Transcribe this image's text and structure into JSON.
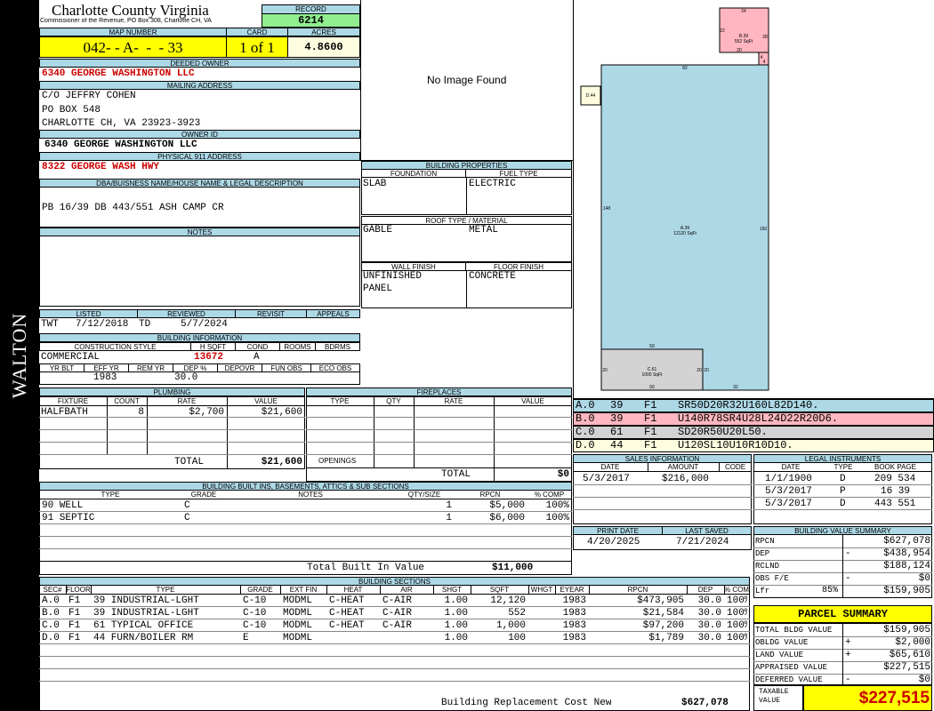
{
  "side_label": "WALTON",
  "county": {
    "title": "Charlotte County Virginia",
    "subtitle": "Commissioner of the Revenue, PO Box 308, Charlotte CH, VA"
  },
  "record": {
    "label": "RECORD",
    "value": "6214"
  },
  "map": {
    "label": "MAP NUMBER",
    "value": "042- - A-  -  - 33",
    "card_label": "CARD",
    "card": "1 of 1",
    "acres_label": "ACRES",
    "acres": "4.8600"
  },
  "owner": {
    "label": "DEEDED OWNER",
    "name": "6340 GEORGE WASHINGTON LLC",
    "mail_label": "MAILING ADDRESS",
    "mail": [
      "C/O JEFFRY COHEN",
      "PO BOX 548",
      "CHARLOTTE CH, VA 23923-3923"
    ],
    "id_label": "OWNER ID",
    "id": "6340 GEORGE WASHINGTON LLC",
    "addr_label": "PHYSICAL 911 ADDRESS",
    "addr": "8322 GEORGE WASH HWY"
  },
  "legal": {
    "label": "DBA/BUISNESS NAME/HOUSE NAME & LEGAL DESCRIPTION",
    "text": "PB 16/39 DB 443/551 ASH CAMP CR"
  },
  "notes": {
    "label": "NOTES"
  },
  "photo": {
    "text": "No Image Found"
  },
  "props": {
    "label": "BUILDING PROPERTIES",
    "foundation_label": "FOUNDATION",
    "foundation": "SLAB",
    "fuel_label": "FUEL TYPE",
    "fuel": "ELECTRIC",
    "roof_label": "ROOF TYPE / MATERIAL",
    "roof_type": "GABLE",
    "roof_mat": "METAL",
    "wall_label": "WALL FINISH",
    "wall": [
      "UNFINISHED",
      "PANEL"
    ],
    "floor_label": "FLOOR FINISH",
    "floor": "CONCRETE"
  },
  "status": {
    "listed_label": "LISTED",
    "listed_by": "TWT",
    "listed": "7/12/2018",
    "reviewed_label": "REVIEWED",
    "reviewed_by": "TD",
    "reviewed": "5/7/2024",
    "revisit_label": "REVISIT",
    "appeals_label": "APPEALS"
  },
  "info": {
    "label": "BUILDING INFORMATION",
    "style_label": "CONSTRUCTION STYLE",
    "style": "COMMERCIAL",
    "hsqft_label": "H SQFT",
    "hsqft": "13672",
    "cond_label": "COND",
    "cond": "A",
    "rooms_label": "ROOMS",
    "bdrms_label": "BDRMS",
    "yrblt_label": "YR BLT",
    "effyr_label": "EFF YR",
    "effyr": "1983",
    "remyr_label": "REM YR",
    "dep_label": "DEP %",
    "dep": "30.0",
    "depovr_label": "DEPOVR",
    "funobs_label": "FUN OBS",
    "ecoobs_label": "ECO OBS"
  },
  "plumbing": {
    "label": "PLUMBING",
    "headers": [
      "FIXTURE",
      "COUNT",
      "RATE",
      "VALUE"
    ],
    "rows": [
      [
        "HALFBATH",
        "8",
        "$2,700",
        "$21,600"
      ]
    ],
    "total_label": "TOTAL",
    "total": "$21,600"
  },
  "fireplaces": {
    "label": "FIREPLACES",
    "headers": [
      "TYPE",
      "QTY",
      "RATE",
      "VALUE"
    ],
    "openings_label": "OPENINGS",
    "total_label": "TOTAL",
    "total": "$0"
  },
  "builtins": {
    "label": "BUILDING BUILT INS, BASEMENTS, ATTICS & SUB SECTIONS",
    "headers": [
      "TYPE",
      "GRADE",
      "NOTES",
      "QTY/SIZE",
      "RPCN",
      "% COMP"
    ],
    "rows": [
      [
        "90 WELL",
        "C",
        "",
        "1",
        "$5,000",
        "100%"
      ],
      [
        "91 SEPTIC",
        "C",
        "",
        "1",
        "$6,000",
        "100%"
      ]
    ],
    "total_label": "Total Built In Value",
    "total": "$11,000"
  },
  "sections": {
    "label": "BUILDING SECTIONS",
    "headers": [
      "SEC#",
      "FLOOR",
      "TYPE",
      "GRADE",
      "EXT FIN",
      "HEAT",
      "AIR",
      "SHGT",
      "SQFT",
      "WHGT",
      "EYEAR",
      "RPCN",
      "DEP",
      "% COMP"
    ],
    "rows": [
      [
        "A.0",
        "F1",
        "39 INDUSTRIAL-LGHT",
        "C-10",
        "MODML",
        "C-HEAT",
        "C-AIR",
        "1.00",
        "12,120",
        "",
        "1983",
        "$473,905",
        "30.0",
        "100%"
      ],
      [
        "B.0",
        "F1",
        "39 INDUSTRIAL-LGHT",
        "C-10",
        "MODML",
        "C-HEAT",
        "C-AIR",
        "1.00",
        "552",
        "",
        "1983",
        "$21,584",
        "30.0",
        "100%"
      ],
      [
        "C.0",
        "F1",
        "61 TYPICAL OFFICE",
        "C-10",
        "MODML",
        "C-HEAT",
        "C-AIR",
        "1.00",
        "1,000",
        "",
        "1983",
        "$97,200",
        "30.0",
        "100%"
      ],
      [
        "D.0",
        "F1",
        "44 FURN/BOILER RM",
        "E",
        "MODML",
        "",
        "",
        "1.00",
        "100",
        "",
        "1983",
        "$1,789",
        "30.0",
        "100%"
      ]
    ],
    "rcn_label": "Building Replacement Cost New",
    "rcn": "$627,078"
  },
  "sketch": {
    "a_label": "A.39",
    "a_area": "12120 SqFt",
    "b_label": "B.39",
    "b_area": "552 SqFt",
    "c_label": "C.61",
    "c_area": "1000 SqFt",
    "d_label": "D.44",
    "dims": [
      "24",
      "22",
      "28",
      "20",
      "4",
      "4",
      "82",
      "148",
      "150",
      "50",
      "20",
      "20",
      "20",
      "50",
      "32"
    ],
    "a_color": "#add8e6",
    "b_color": "#ffb6c1",
    "c_color": "#d3d3d3",
    "d_color": "#fffde0"
  },
  "codes": [
    {
      "sec": "A.0",
      "type": "39",
      "floor": "F1",
      "path": "SR50D20R32U160L82D140.",
      "bg": "#add8e6"
    },
    {
      "sec": "B.0",
      "type": "39",
      "floor": "F1",
      "path": "U140R78SR4U28L24D22R20D6.",
      "bg": "#ffb6c1"
    },
    {
      "sec": "C.0",
      "type": "61",
      "floor": "F1",
      "path": "SD20R50U20L50.",
      "bg": "#d3d3d3"
    },
    {
      "sec": "D.0",
      "type": "44",
      "floor": "F1",
      "path": "U120SL10U10R10D10.",
      "bg": "#fffde0"
    }
  ],
  "sales": {
    "label": "SALES INFORMATION",
    "headers": [
      "DATE",
      "AMOUNT",
      "CODE"
    ],
    "rows": [
      [
        "5/3/2017",
        "$216,000",
        ""
      ]
    ]
  },
  "instruments": {
    "label": "LEGAL INSTRUMENTS",
    "headers": [
      "DATE",
      "TYPE",
      "BOOK PAGE"
    ],
    "rows": [
      [
        "1/1/1900",
        "D",
        "209 534"
      ],
      [
        "5/3/2017",
        "P",
        "16 39"
      ],
      [
        "5/3/2017",
        "D",
        "443 551"
      ]
    ]
  },
  "dates": {
    "print_label": "PRINT DATE",
    "print": "4/20/2025",
    "saved_label": "LAST SAVED",
    "saved": "7/21/2024"
  },
  "value_summary": {
    "label": "BUILDING VALUE SUMMARY",
    "rows": [
      {
        "label": "RPCN",
        "sign": "",
        "pct": "",
        "value": "$627,078"
      },
      {
        "label": "DEP",
        "sign": "-",
        "pct": "",
        "value": "$438,954"
      },
      {
        "label": "RCLND",
        "sign": "",
        "pct": "",
        "value": "$188,124"
      },
      {
        "label": "OBS F/E",
        "sign": "-",
        "pct": "",
        "value": "$0"
      },
      {
        "label": "Lfr",
        "sign": "",
        "pct": "85%",
        "value": "$159,905"
      }
    ]
  },
  "parcel": {
    "label": "PARCEL SUMMARY",
    "rows": [
      {
        "label": "TOTAL BLDG VALUE",
        "sign": "",
        "value": "$159,905"
      },
      {
        "label": "OBLDG VALUE",
        "sign": "+",
        "value": "$2,000"
      },
      {
        "label": "LAND VALUE",
        "sign": "+",
        "value": "$65,610"
      },
      {
        "label": "APPRAISED VALUE",
        "sign": "",
        "value": "$227,515"
      },
      {
        "label": "DEFERRED VALUE",
        "sign": "-",
        "value": "$0"
      }
    ],
    "taxable_label": "TAXABLE VALUE",
    "taxable": "$227,515"
  }
}
